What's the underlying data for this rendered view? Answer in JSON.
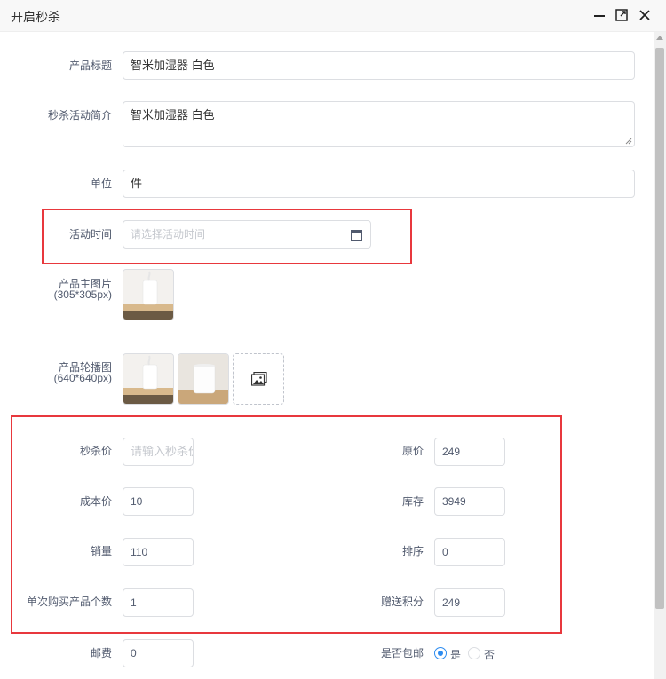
{
  "window": {
    "title": "开启秒杀",
    "icons": [
      "minimize-icon",
      "maximize-icon",
      "close-icon"
    ]
  },
  "form": {
    "product_title": {
      "label": "产品标题",
      "value": "智米加湿器 白色"
    },
    "intro": {
      "label": "秒杀活动简介",
      "value": "智米加湿器 白色"
    },
    "unit": {
      "label": "单位",
      "value": "件"
    },
    "activity_time": {
      "label": "活动时间",
      "placeholder": "请选择活动时间"
    },
    "main_image": {
      "label": "产品主图片",
      "hint": "(305*305px)"
    },
    "carousel": {
      "label": "产品轮播图",
      "hint": "(640*640px)"
    },
    "seckill_price": {
      "label": "秒杀价",
      "placeholder": "请输入秒杀价"
    },
    "original_price": {
      "label": "原价",
      "value": "249"
    },
    "cost_price": {
      "label": "成本价",
      "value": "10"
    },
    "stock": {
      "label": "库存",
      "value": "3949"
    },
    "sales": {
      "label": "销量",
      "value": "110"
    },
    "sort": {
      "label": "排序",
      "value": "0"
    },
    "per_purchase": {
      "label": "单次购买产品个数",
      "value": "1"
    },
    "bonus_points": {
      "label": "赠送积分",
      "value": "249"
    },
    "postage": {
      "label": "邮费",
      "value": "0"
    },
    "free_shipping": {
      "label": "是否包邮",
      "options": [
        "是",
        "否"
      ],
      "selected": "是"
    }
  },
  "colors": {
    "highlight": "#e8383d",
    "radio_active": "#2d8cf0",
    "border": "#dcdee2"
  }
}
